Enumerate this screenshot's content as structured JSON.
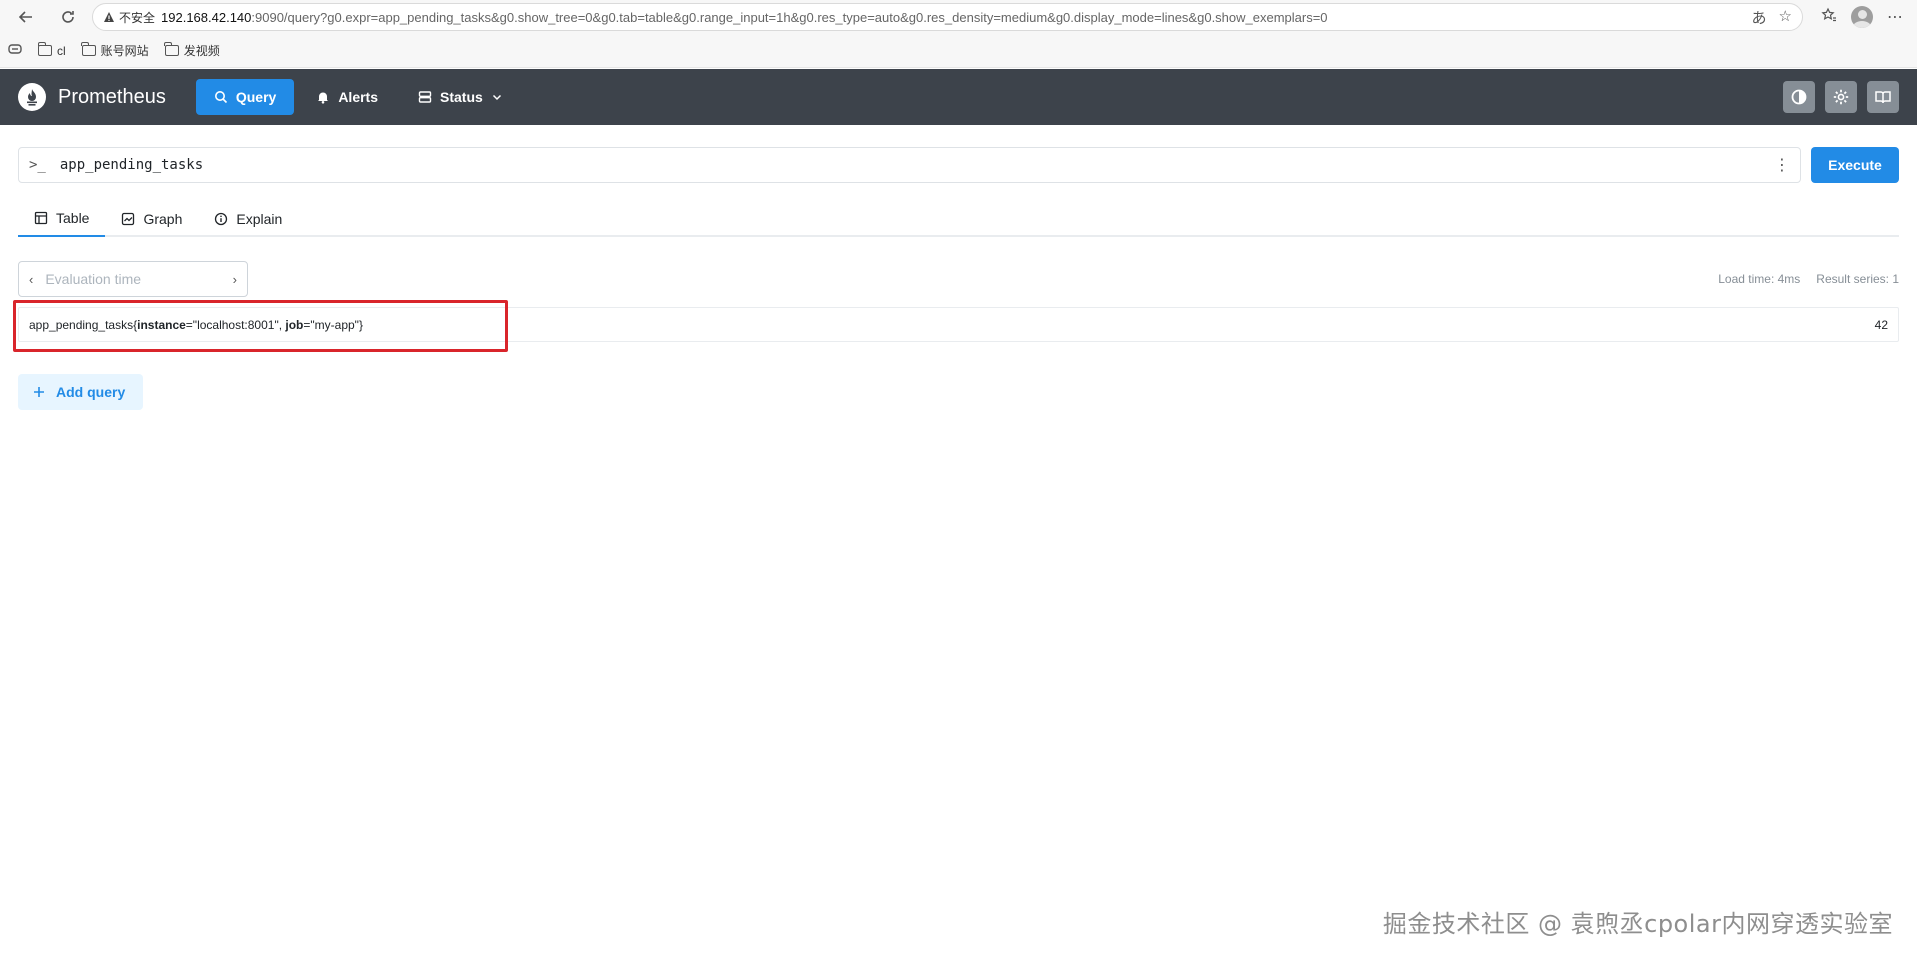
{
  "browser": {
    "security_label": "不安全",
    "url_host": "192.168.42.140",
    "url_rest": ":9090/query?g0.expr=app_pending_tasks&g0.show_tree=0&g0.tab=table&g0.range_input=1h&g0.res_type=auto&g0.res_density=medium&g0.display_mode=lines&g0.show_exemplars=0",
    "bookmarks": [
      "cl",
      "账号网站",
      "发视频"
    ]
  },
  "header": {
    "brand": "Prometheus",
    "nav": {
      "query": "Query",
      "alerts": "Alerts",
      "status": "Status"
    }
  },
  "query": {
    "prompt": ">_",
    "expression": "app_pending_tasks",
    "execute_label": "Execute"
  },
  "tabs": {
    "table": "Table",
    "graph": "Graph",
    "explain": "Explain"
  },
  "evaluation": {
    "placeholder": "Evaluation time",
    "load_time": "Load time: 4ms",
    "result_series": "Result series: 1"
  },
  "result": {
    "metric_name": "app_pending_tasks",
    "open_brace": "{",
    "label1_key": "instance",
    "label1_eq": "=\"localhost:8001\", ",
    "label2_key": "job",
    "label2_eq": "=\"my-app\"",
    "close_brace": "}",
    "value": "42"
  },
  "add_query_label": "Add query",
  "watermark": "掘金技术社区 @ 袁煦丞cpolar内网穿透实验室",
  "colors": {
    "accent": "#228be6",
    "header_bg": "#3d434b",
    "highlight": "#d9252b"
  }
}
